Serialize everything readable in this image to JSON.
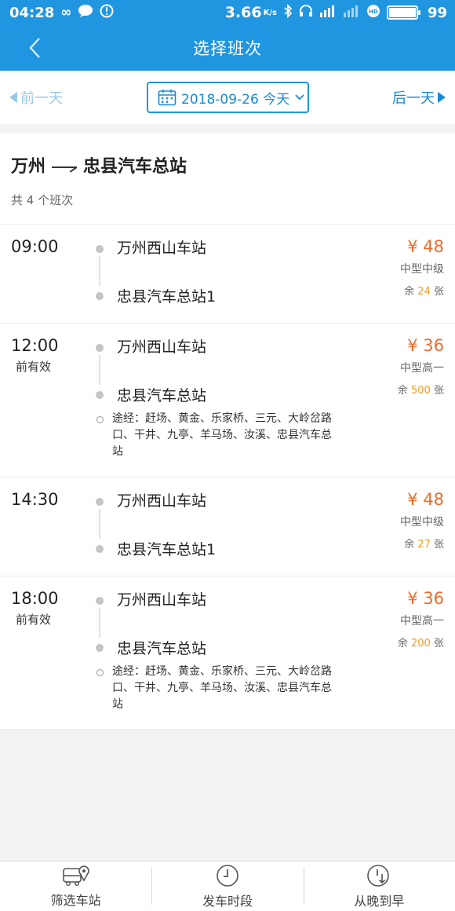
{
  "status_bar": {
    "time": "04:28",
    "net_speed": "3.66",
    "net_speed_unit": "K/s",
    "battery": "99",
    "battery_level": 0.99
  },
  "header": {
    "title": "选择班次"
  },
  "date_bar": {
    "prev_day": "前一天",
    "next_day": "后一天",
    "date": "2018-09-26 今天"
  },
  "route": {
    "title_from": "万州",
    "title_to": "忠县汽车总站",
    "count_text": "共 4 个班次"
  },
  "trips": [
    {
      "time": "09:00",
      "note": "",
      "from_stop": "万州西山车站",
      "to_stop": "忠县汽车总站1",
      "price": "¥ 48",
      "bus_type": "中型中级",
      "seats_prefix": "余",
      "seats_count": "24",
      "seats_suffix": "张",
      "via": ""
    },
    {
      "time": "12:00",
      "note": "前有效",
      "from_stop": "万州西山车站",
      "to_stop": "忠县汽车总站",
      "price": "¥ 36",
      "bus_type": "中型高一",
      "seats_prefix": "余",
      "seats_count": "500",
      "seats_suffix": "张",
      "via": "途经：赶场、黄金、乐家桥、三元、大岭岔路口、干井、九亭、羊马场、汝溪、忠县汽车总站"
    },
    {
      "time": "14:30",
      "note": "",
      "from_stop": "万州西山车站",
      "to_stop": "忠县汽车总站1",
      "price": "¥ 48",
      "bus_type": "中型中级",
      "seats_prefix": "余",
      "seats_count": "27",
      "seats_suffix": "张",
      "via": ""
    },
    {
      "time": "18:00",
      "note": "前有效",
      "from_stop": "万州西山车站",
      "to_stop": "忠县汽车总站",
      "price": "¥ 36",
      "bus_type": "中型高一",
      "seats_prefix": "余",
      "seats_count": "200",
      "seats_suffix": "张",
      "via": "途经：赶场、黄金、乐家桥、三元、大岭岔路口、干井、九亭、羊马场、汝溪、忠县汽车总站"
    }
  ],
  "bottom_bar": {
    "filter_label": "筛选车站",
    "period_label": "发车时段",
    "sort_label": "从晚到早"
  },
  "colors": {
    "primary": "#2196e0",
    "price": "#ef6b2a",
    "seat_count": "#f39a1e"
  }
}
